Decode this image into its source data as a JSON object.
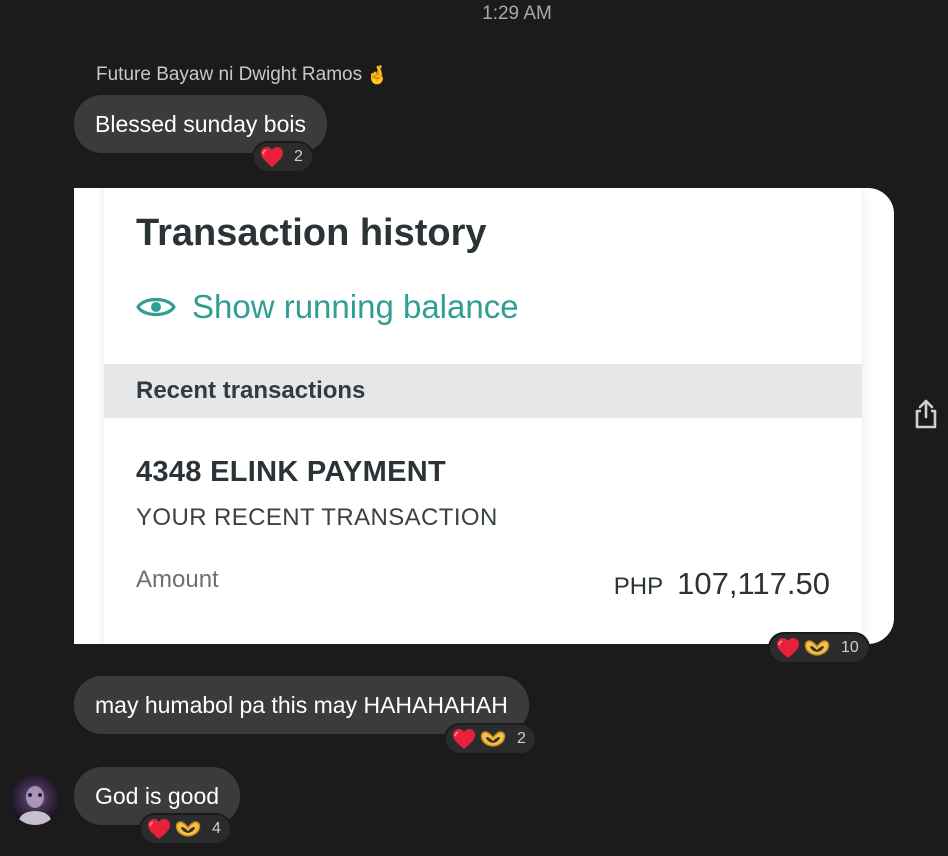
{
  "header": {
    "timestamp": "1:29 AM"
  },
  "messages": [
    {
      "sender": "Future Bayaw ni Dwight Ramos",
      "sender_emoji": "🤞",
      "text": "Blessed sunday bois",
      "reactions": {
        "icons": [
          "heart-icon"
        ],
        "count": "2"
      }
    },
    {
      "type": "image-attachment",
      "reactions": {
        "icons": [
          "heart-icon",
          "heart-hands-icon"
        ],
        "count": "10"
      },
      "screenshot": {
        "title": "Transaction history",
        "show_running_balance": "Show running balance",
        "section_header": "Recent transactions",
        "transaction": {
          "name": "4348 ELINK PAYMENT",
          "description": "YOUR RECENT TRANSACTION",
          "amount_label": "Amount",
          "currency": "PHP",
          "amount": "107,117.50"
        }
      }
    },
    {
      "text": "may humabol pa this may HAHAHAHAH",
      "reactions": {
        "icons": [
          "heart-icon",
          "heart-hands-icon"
        ],
        "count": "2"
      }
    },
    {
      "text": "God is good",
      "reactions": {
        "icons": [
          "heart-icon",
          "heart-hands-icon"
        ],
        "count": "4"
      }
    }
  ],
  "colors": {
    "background": "#1b1b1b",
    "bubble": "#3a3b3c",
    "accent_teal": "#2f9f93",
    "heart": "#e8213b",
    "hands": "#f4c04d"
  }
}
